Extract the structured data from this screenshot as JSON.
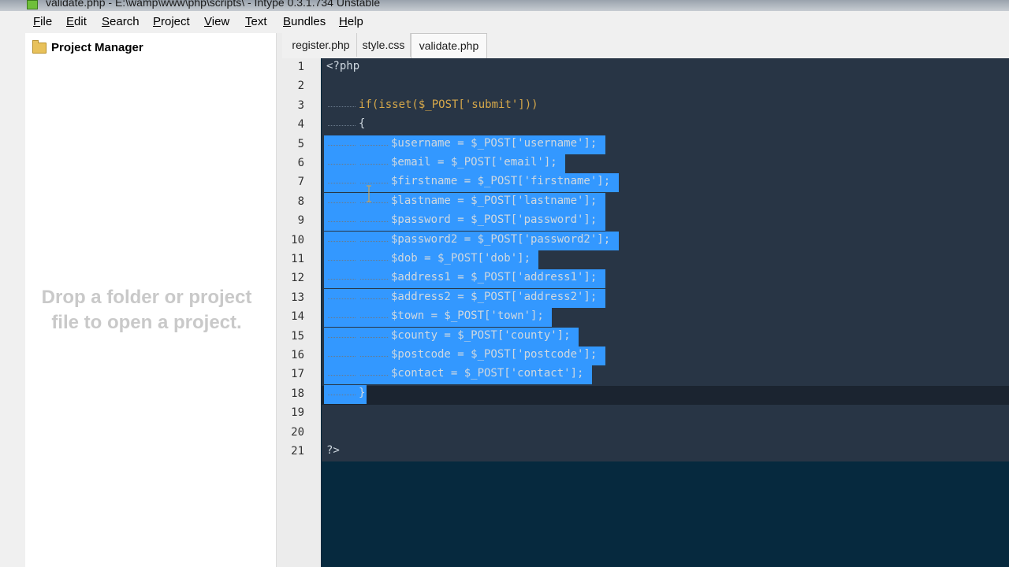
{
  "window": {
    "title": "validate.php - E:\\wamp\\www\\php\\scripts\\ - Intype 0.3.1.734 Unstable"
  },
  "menu": [
    {
      "label": "File",
      "ul": "F",
      "rest": "ile"
    },
    {
      "label": "Edit",
      "ul": "E",
      "rest": "dit"
    },
    {
      "label": "Search",
      "ul": "S",
      "rest": "earch"
    },
    {
      "label": "Project",
      "ul": "P",
      "rest": "roject"
    },
    {
      "label": "View",
      "ul": "V",
      "rest": "iew"
    },
    {
      "label": "Text",
      "ul": "T",
      "rest": "ext"
    },
    {
      "label": "Bundles",
      "ul": "B",
      "rest": "undles"
    },
    {
      "label": "Help",
      "ul": "H",
      "rest": "elp"
    }
  ],
  "project_manager": {
    "title": "Project Manager",
    "hint": "Drop a folder or project file to open a project."
  },
  "tabs": [
    {
      "label": "register.php",
      "active": false
    },
    {
      "label": "style.css",
      "active": false
    },
    {
      "label": "validate.php",
      "active": true
    }
  ],
  "editor": {
    "selection_color": "#3398ff",
    "background": "#283545",
    "lines": [
      {
        "n": "1",
        "text": "<?php",
        "indent": 0,
        "sel": false
      },
      {
        "n": "2",
        "text": "",
        "indent": 0,
        "sel": false
      },
      {
        "n": "3",
        "text": "if(isset($_POST['submit']))",
        "indent": 1,
        "sel": false,
        "kw": true
      },
      {
        "n": "4",
        "text": "{",
        "indent": 1,
        "sel": false
      },
      {
        "n": "5",
        "text": "$username = $_POST['username'];",
        "indent": 2,
        "sel": true
      },
      {
        "n": "6",
        "text": "$email = $_POST['email'];",
        "indent": 2,
        "sel": true
      },
      {
        "n": "7",
        "text": "$firstname = $_POST['firstname'];",
        "indent": 2,
        "sel": true
      },
      {
        "n": "8",
        "text": "$lastname = $_POST['lastname'];",
        "indent": 2,
        "sel": true
      },
      {
        "n": "9",
        "text": "$password = $_POST['password'];",
        "indent": 2,
        "sel": true
      },
      {
        "n": "10",
        "text": "$password2 = $_POST['password2'];",
        "indent": 2,
        "sel": true
      },
      {
        "n": "11",
        "text": "$dob = $_POST['dob'];",
        "indent": 2,
        "sel": true
      },
      {
        "n": "12",
        "text": "$address1 = $_POST['address1'];",
        "indent": 2,
        "sel": true
      },
      {
        "n": "13",
        "text": "$address2 = $_POST['address2'];",
        "indent": 2,
        "sel": true
      },
      {
        "n": "14",
        "text": "$town = $_POST['town'];",
        "indent": 2,
        "sel": true
      },
      {
        "n": "15",
        "text": "$county = $_POST['county'];",
        "indent": 2,
        "sel": true
      },
      {
        "n": "16",
        "text": "$postcode = $_POST['postcode'];",
        "indent": 2,
        "sel": true
      },
      {
        "n": "17",
        "text": "$contact = $_POST['contact'];",
        "indent": 2,
        "sel": true
      },
      {
        "n": "18",
        "text": "}",
        "indent": 1,
        "sel": true,
        "current": true
      },
      {
        "n": "19",
        "text": "",
        "indent": 0,
        "sel": false
      },
      {
        "n": "20",
        "text": "",
        "indent": 0,
        "sel": false
      },
      {
        "n": "21",
        "text": "?>",
        "indent": 0,
        "sel": false
      }
    ]
  }
}
